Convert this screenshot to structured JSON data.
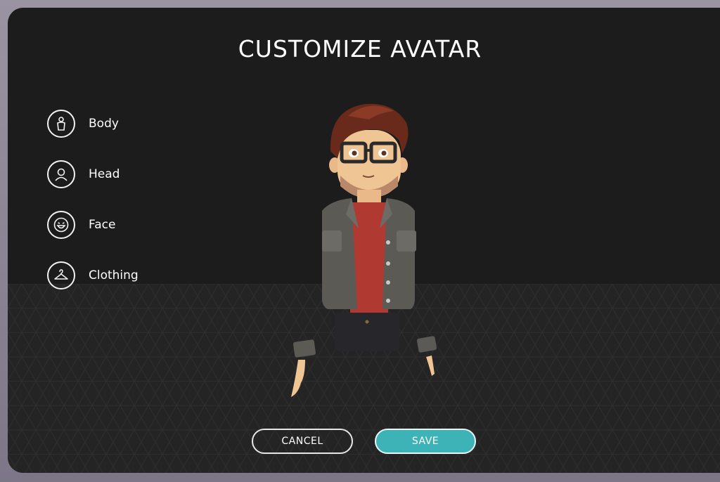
{
  "title": "CUSTOMIZE AVATAR",
  "menu": {
    "items": [
      {
        "label": "Body",
        "icon": "body-icon"
      },
      {
        "label": "Head",
        "icon": "head-icon"
      },
      {
        "label": "Face",
        "icon": "face-icon"
      },
      {
        "label": "Clothing",
        "icon": "hanger-icon"
      }
    ]
  },
  "buttons": {
    "cancel_label": "CANCEL",
    "save_label": "SAVE"
  },
  "colors": {
    "panel": "#1c1c1c",
    "floor": "#242424",
    "accent": "#3db3b8",
    "text": "#ffffff"
  }
}
